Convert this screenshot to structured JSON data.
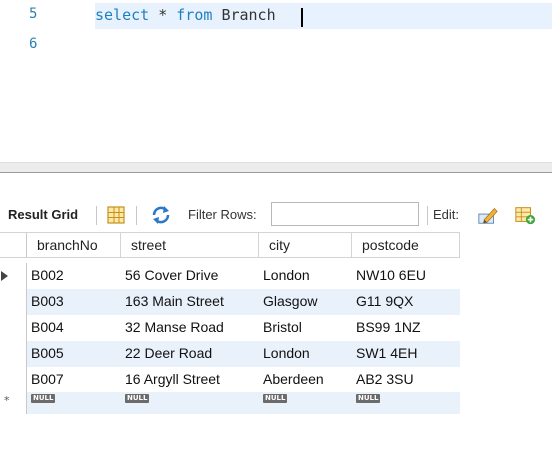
{
  "editor": {
    "lines": [
      {
        "number": "5",
        "keyword1": "select",
        "star": " * ",
        "keyword2": "from",
        "space": " ",
        "identifier": "Branch"
      },
      {
        "number": "6"
      }
    ]
  },
  "toolbar": {
    "result_grid_label": "Result Grid",
    "grid_icon": "grid-layout-icon",
    "refresh_icon": "refresh-arrows-icon",
    "filter_label": "Filter Rows:",
    "filter_value": "",
    "edit_label": "Edit:",
    "edit_icon": "pencil-edit-icon",
    "add_row_icon": "add-row-icon"
  },
  "grid": {
    "columns": [
      "branchNo",
      "street",
      "city",
      "postcode"
    ],
    "rows": [
      [
        "B002",
        "56 Cover Drive",
        "London",
        "NW10 6EU"
      ],
      [
        "B003",
        "163 Main Street",
        "Glasgow",
        "G11 9QX"
      ],
      [
        "B004",
        "32 Manse Road",
        "Bristol",
        "BS99 1NZ"
      ],
      [
        "B005",
        "22 Deer Road",
        "London",
        "SW1 4EH"
      ],
      [
        "B007",
        "16 Argyll Street",
        "Aberdeen",
        "AB2 3SU"
      ]
    ],
    "new_row": [
      "NULL",
      "NULL",
      "NULL",
      "NULL"
    ],
    "new_row_marker": "*"
  },
  "colors": {
    "keyword": "#1e7fc0",
    "line_number": "#2b7fb2",
    "current_line": "#e8f2fe",
    "row_stripe": "#e9f1fb"
  }
}
